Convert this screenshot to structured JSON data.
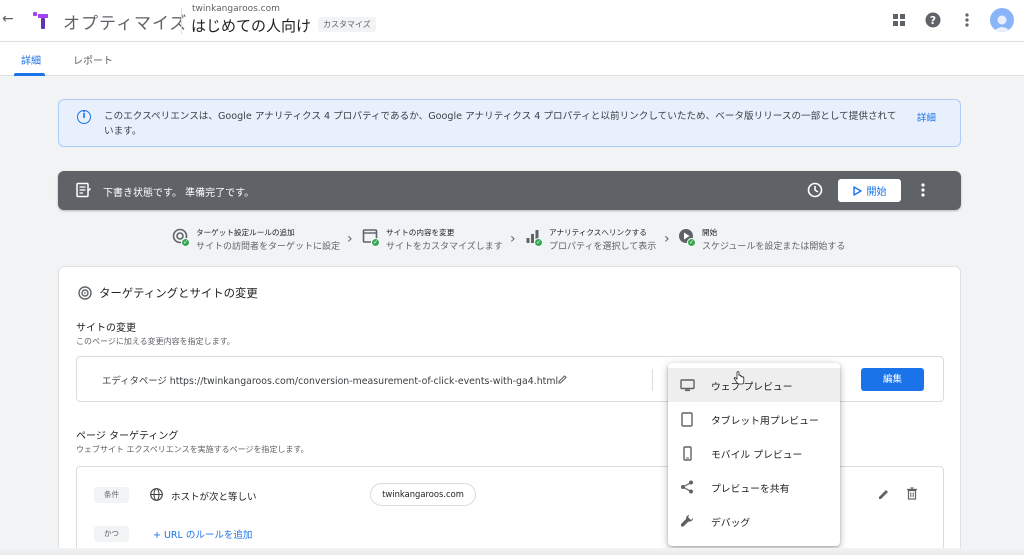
{
  "appbar": {
    "back_glyph": "←",
    "app_name": "オプティマイズ",
    "domain": "twinkangaroos.com",
    "experience_name": "はじめての人向け",
    "experience_type": "カスタマイズ"
  },
  "tabs": [
    {
      "label": "詳細",
      "active": true
    },
    {
      "label": "レポート",
      "active": false
    }
  ],
  "banner": {
    "text": "このエクスペリエンスは、Google アナリティクス 4 プロパティであるか、Google アナリティクス 4 プロパティと以前リンクしていたため、ベータ版リリースの一部として提供されています。",
    "link": "詳細"
  },
  "status": {
    "text": "下書き状態です。 準備完了です。",
    "start_label": "開始"
  },
  "steps": [
    {
      "title": "ターゲット設定ルールの追加",
      "subtitle": "サイトの訪問者をターゲットに設定"
    },
    {
      "title": "サイトの内容を変更",
      "subtitle": "サイトをカスタマイズします"
    },
    {
      "title": "アナリティクスへリンクする",
      "subtitle": "プロパティを選択して表示"
    },
    {
      "title": "開始",
      "subtitle": "スケジュールを設定または開始する"
    }
  ],
  "card": {
    "title": "ターゲティングとサイトの変更",
    "site_changes": {
      "title": "サイトの変更",
      "subtitle": "このページに加える変更内容を指定します。",
      "editor_label": "エディタページ",
      "editor_url": "https://twinkangaroos.com/conversion-measurement-of-click-events-with-ga4.html",
      "edit_button": "編集"
    },
    "page_targeting": {
      "title": "ページ ターゲティング",
      "subtitle": "ウェブサイト エクスペリエンスを実施するページを指定します。",
      "condition_chip": "条件",
      "rule_label": "ホストが次と等しい",
      "rule_value": "twinkangaroos.com",
      "and_chip": "かつ",
      "add_rule": "+ URL のルールを追加"
    }
  },
  "preview_menu": [
    {
      "label": "ウェブ プレビュー",
      "icon": "monitor-icon",
      "hover": true
    },
    {
      "label": "タブレット用プレビュー",
      "icon": "tablet-icon",
      "hover": false
    },
    {
      "label": "モバイル プレビュー",
      "icon": "phone-icon",
      "hover": false
    },
    {
      "label": "プレビューを共有",
      "icon": "share-icon",
      "hover": false
    },
    {
      "label": "デバッグ",
      "icon": "wrench-icon",
      "hover": false
    }
  ],
  "colors": {
    "accent": "#1a73e8",
    "status_bar": "#5f6368",
    "banner_bg": "#e8f0fe",
    "success": "#34a853"
  }
}
